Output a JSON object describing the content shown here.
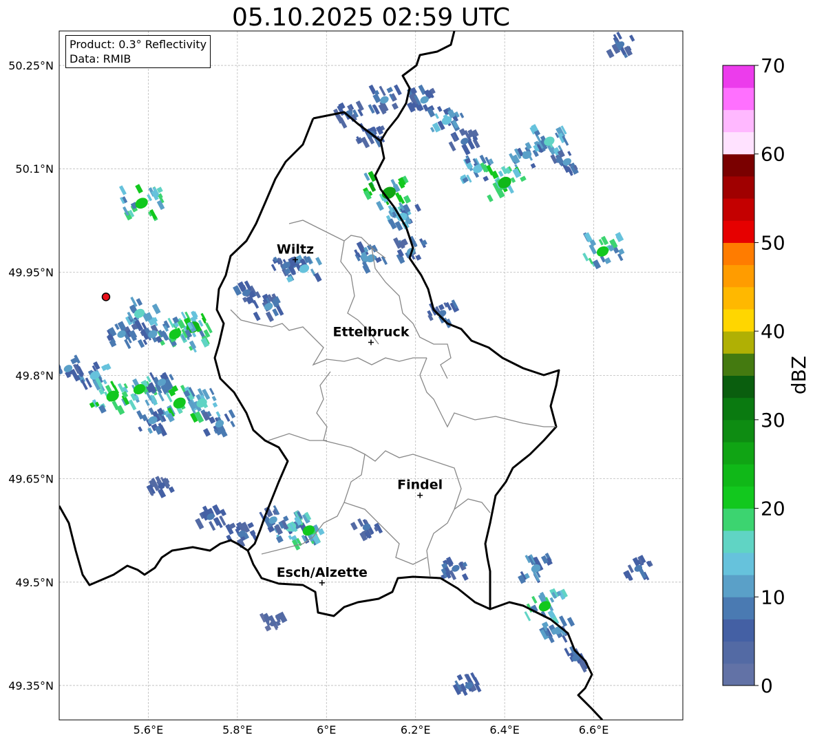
{
  "title": "05.10.2025 02:59 UTC",
  "info": {
    "product": "Product: 0.3° Reflectivity",
    "data": "Data: RMIB"
  },
  "map": {
    "lon_range": [
      5.4,
      6.8
    ],
    "lat_range": [
      49.3,
      50.3
    ],
    "lon_ticks": [
      {
        "v": 5.6,
        "label": "5.6°E"
      },
      {
        "v": 5.8,
        "label": "5.8°E"
      },
      {
        "v": 6.0,
        "label": "6°E"
      },
      {
        "v": 6.2,
        "label": "6.2°E"
      },
      {
        "v": 6.4,
        "label": "6.4°E"
      },
      {
        "v": 6.6,
        "label": "6.6°E"
      }
    ],
    "lat_ticks": [
      {
        "v": 50.25,
        "label": "50.25°N"
      },
      {
        "v": 50.1,
        "label": "50.1°N"
      },
      {
        "v": 49.95,
        "label": "49.95°N"
      },
      {
        "v": 49.8,
        "label": "49.8°N"
      },
      {
        "v": 49.65,
        "label": "49.65°N"
      },
      {
        "v": 49.5,
        "label": "49.5°N"
      },
      {
        "v": 49.35,
        "label": "49.35°N"
      }
    ],
    "cities": [
      {
        "name": "Wiltz",
        "lon": 5.93,
        "lat": 49.968
      },
      {
        "name": "Ettelbruck",
        "lon": 6.1,
        "lat": 49.848
      },
      {
        "name": "Findel",
        "lon": 6.21,
        "lat": 49.626
      },
      {
        "name": "Esch/Alzette",
        "lon": 5.99,
        "lat": 49.499
      }
    ],
    "radar_site": {
      "lon": 5.505,
      "lat": 49.914,
      "color": "#e8101a"
    }
  },
  "colorbar": {
    "label": "dBZ",
    "min": 0,
    "max": 70,
    "tick_values": [
      0,
      10,
      20,
      30,
      40,
      50,
      60,
      70
    ],
    "colors": [
      "#6272a6",
      "#536aa4",
      "#4460a4",
      "#4a7ab2",
      "#5aa0c8",
      "#66c2dc",
      "#60d4c4",
      "#3cd470",
      "#12c81e",
      "#10b818",
      "#10a414",
      "#0e8c12",
      "#0a7a10",
      "#0a5e0e",
      "#447a10",
      "#b0b004",
      "#ffd600",
      "#ffb800",
      "#ff9c00",
      "#ff7c00",
      "#e60000",
      "#c40000",
      "#a00000",
      "#7a0000",
      "#ffe2ff",
      "#ffb8ff",
      "#ff70ff",
      "#ec3cec"
    ]
  },
  "echoes": [
    {
      "lon": 5.95,
      "lat": 49.955,
      "dbz": 14
    },
    {
      "lon": 5.91,
      "lat": 49.96,
      "dbz": 8
    },
    {
      "lon": 5.87,
      "lat": 49.9,
      "dbz": 10
    },
    {
      "lon": 5.82,
      "lat": 49.92,
      "dbz": 8
    },
    {
      "lon": 6.1,
      "lat": 49.97,
      "dbz": 12
    },
    {
      "lon": 6.14,
      "lat": 50.065,
      "dbz": 26
    },
    {
      "lon": 6.17,
      "lat": 50.03,
      "dbz": 14
    },
    {
      "lon": 6.19,
      "lat": 49.98,
      "dbz": 10
    },
    {
      "lon": 6.1,
      "lat": 50.15,
      "dbz": 8
    },
    {
      "lon": 6.05,
      "lat": 50.18,
      "dbz": 8
    },
    {
      "lon": 6.13,
      "lat": 50.2,
      "dbz": 10
    },
    {
      "lon": 6.22,
      "lat": 50.2,
      "dbz": 10
    },
    {
      "lon": 6.27,
      "lat": 50.17,
      "dbz": 14
    },
    {
      "lon": 6.31,
      "lat": 50.14,
      "dbz": 8
    },
    {
      "lon": 6.34,
      "lat": 50.1,
      "dbz": 14
    },
    {
      "lon": 6.4,
      "lat": 50.08,
      "dbz": 24
    },
    {
      "lon": 6.45,
      "lat": 50.12,
      "dbz": 12
    },
    {
      "lon": 6.5,
      "lat": 50.14,
      "dbz": 16
    },
    {
      "lon": 6.54,
      "lat": 50.11,
      "dbz": 10
    },
    {
      "lon": 6.62,
      "lat": 49.98,
      "dbz": 20
    },
    {
      "lon": 6.66,
      "lat": 50.28,
      "dbz": 8
    },
    {
      "lon": 6.26,
      "lat": 49.89,
      "dbz": 8
    },
    {
      "lon": 5.7,
      "lat": 49.87,
      "dbz": 24
    },
    {
      "lon": 5.66,
      "lat": 49.86,
      "dbz": 20
    },
    {
      "lon": 5.58,
      "lat": 49.89,
      "dbz": 16
    },
    {
      "lon": 5.61,
      "lat": 49.86,
      "dbz": 12
    },
    {
      "lon": 5.54,
      "lat": 49.86,
      "dbz": 10
    },
    {
      "lon": 5.48,
      "lat": 49.8,
      "dbz": 14
    },
    {
      "lon": 5.52,
      "lat": 49.77,
      "dbz": 22
    },
    {
      "lon": 5.58,
      "lat": 49.78,
      "dbz": 20
    },
    {
      "lon": 5.63,
      "lat": 49.79,
      "dbz": 10
    },
    {
      "lon": 5.67,
      "lat": 49.76,
      "dbz": 22
    },
    {
      "lon": 5.72,
      "lat": 49.76,
      "dbz": 16
    },
    {
      "lon": 5.76,
      "lat": 49.73,
      "dbz": 10
    },
    {
      "lon": 5.61,
      "lat": 49.735,
      "dbz": 12
    },
    {
      "lon": 5.42,
      "lat": 49.81,
      "dbz": 10
    },
    {
      "lon": 5.585,
      "lat": 50.05,
      "dbz": 22
    },
    {
      "lon": 5.92,
      "lat": 49.58,
      "dbz": 16
    },
    {
      "lon": 5.96,
      "lat": 49.575,
      "dbz": 20
    },
    {
      "lon": 5.88,
      "lat": 49.59,
      "dbz": 10
    },
    {
      "lon": 5.81,
      "lat": 49.57,
      "dbz": 8
    },
    {
      "lon": 5.74,
      "lat": 49.595,
      "dbz": 8
    },
    {
      "lon": 6.09,
      "lat": 49.58,
      "dbz": 8
    },
    {
      "lon": 6.29,
      "lat": 49.52,
      "dbz": 8
    },
    {
      "lon": 6.49,
      "lat": 49.465,
      "dbz": 20
    },
    {
      "lon": 6.47,
      "lat": 49.52,
      "dbz": 12
    },
    {
      "lon": 6.52,
      "lat": 49.43,
      "dbz": 12
    },
    {
      "lon": 6.56,
      "lat": 49.39,
      "dbz": 8
    },
    {
      "lon": 6.7,
      "lat": 49.52,
      "dbz": 8
    },
    {
      "lon": 6.32,
      "lat": 49.35,
      "dbz": 8
    },
    {
      "lon": 5.63,
      "lat": 49.64,
      "dbz": 6
    },
    {
      "lon": 5.88,
      "lat": 49.44,
      "dbz": 4
    }
  ]
}
